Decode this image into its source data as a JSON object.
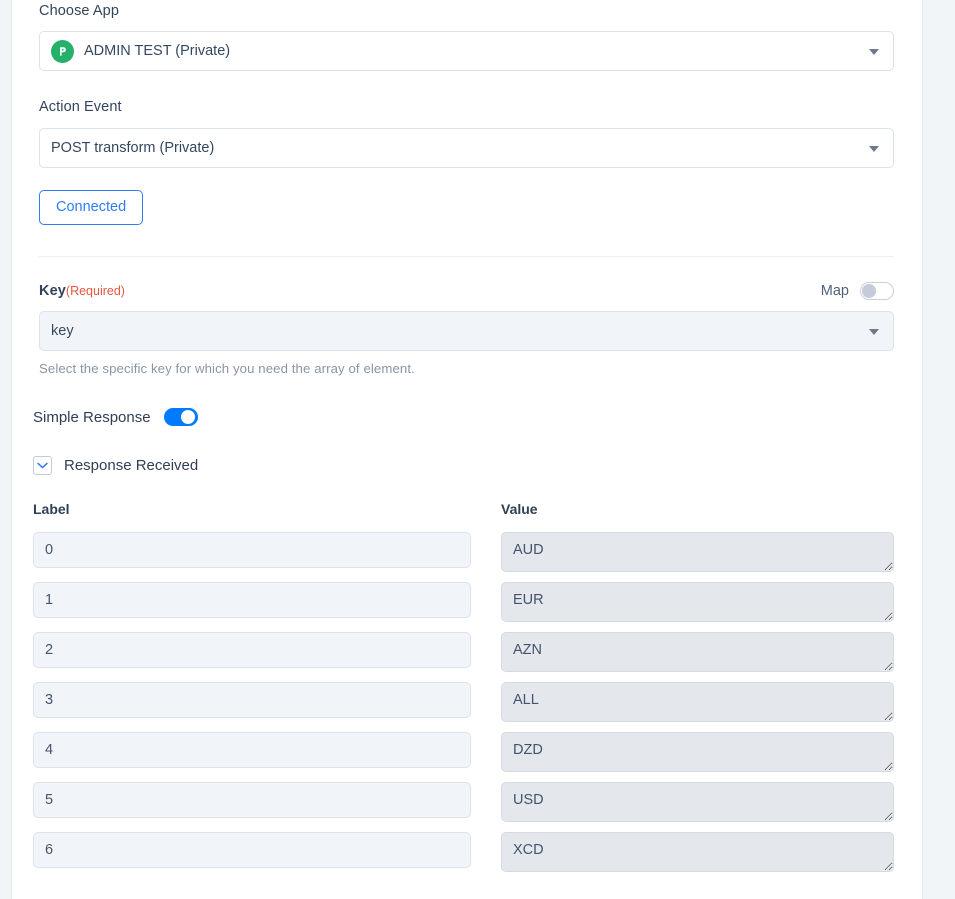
{
  "choose_app": {
    "label": "Choose App",
    "value": "ADMIN TEST (Private)",
    "icon": "app-logo-icon"
  },
  "action_event": {
    "label": "Action Event",
    "value": "POST transform (Private)"
  },
  "connected": {
    "label": "Connected"
  },
  "key_section": {
    "label": "Key",
    "required_text": "(Required)",
    "map_label": "Map",
    "map_toggle_state": "off",
    "value": "key",
    "helper_text": "Select the specific key for which you need the array of element."
  },
  "simple_response": {
    "label": "Simple Response",
    "toggle_state": "on"
  },
  "response_received": {
    "label": "Response Received",
    "collapse_icon": "chevron-down-icon"
  },
  "table": {
    "headers": {
      "label": "Label",
      "value": "Value"
    },
    "rows": [
      {
        "label": "0",
        "value": "AUD"
      },
      {
        "label": "1",
        "value": "EUR"
      },
      {
        "label": "2",
        "value": "AZN"
      },
      {
        "label": "3",
        "value": "ALL"
      },
      {
        "label": "4",
        "value": "DZD"
      },
      {
        "label": "5",
        "value": "USD"
      },
      {
        "label": "6",
        "value": "XCD"
      }
    ]
  },
  "colors": {
    "accent_blue": "#007bff",
    "link_blue": "#2f7df6",
    "required_red": "#e8573f",
    "app_icon_green": "#25b16a",
    "input_fill": "#f1f4f8",
    "textarea_fill": "#e4e8ec",
    "gutter": "#f2f5f8"
  }
}
